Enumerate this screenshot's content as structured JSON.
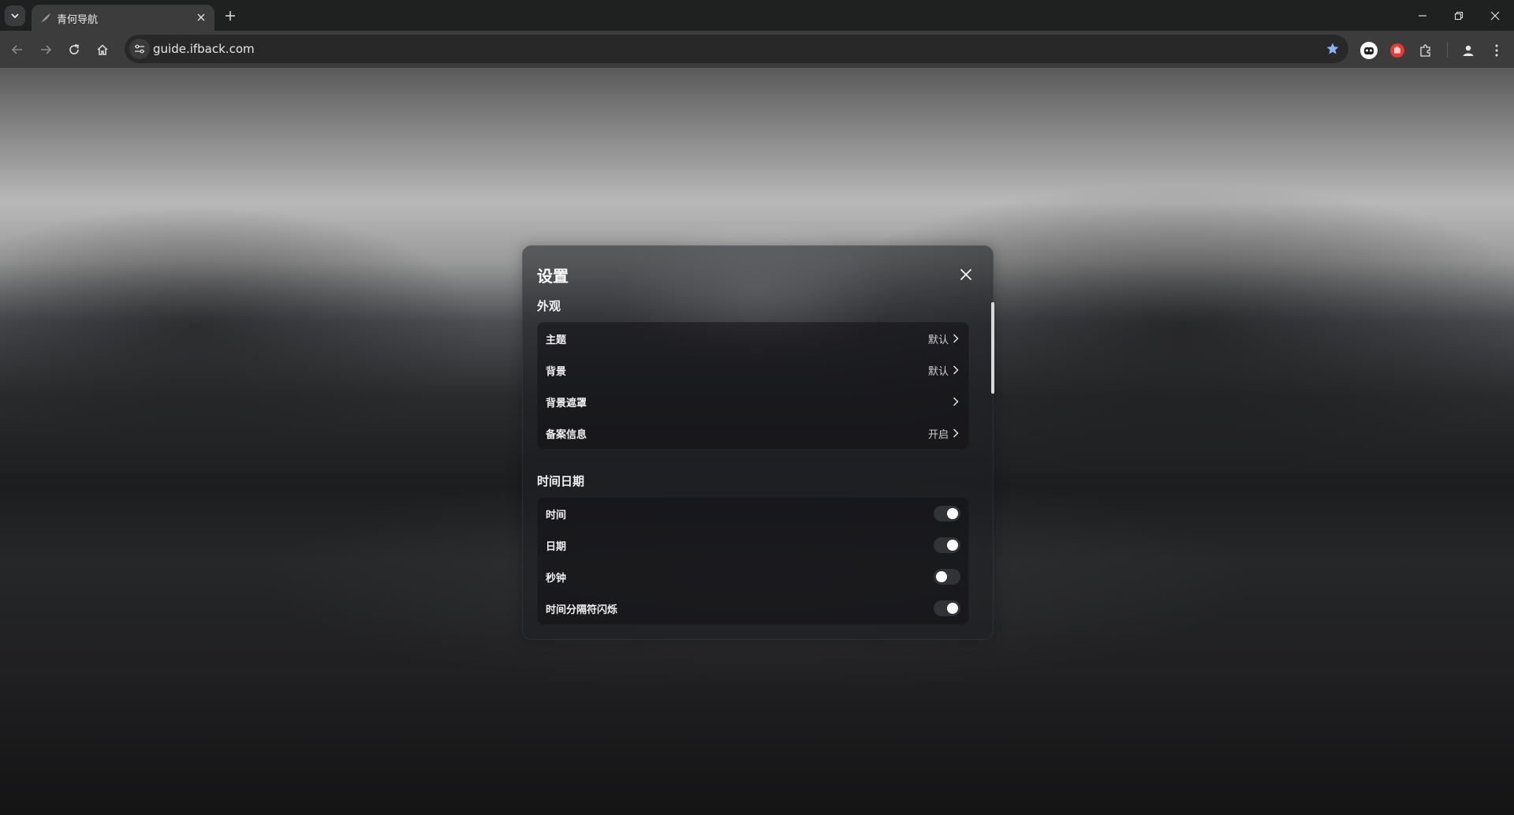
{
  "browser": {
    "tab": {
      "title": "青何导航"
    },
    "address": {
      "url": "guide.ifback.com"
    }
  },
  "settings": {
    "title": "设置",
    "appearance": {
      "title": "外观",
      "items": [
        {
          "label": "主题",
          "value": "默认"
        },
        {
          "label": "背景",
          "value": "默认"
        },
        {
          "label": "背景遮罩",
          "value": ""
        },
        {
          "label": "备案信息",
          "value": "开启"
        }
      ]
    },
    "datetime": {
      "title": "时间日期",
      "items": [
        {
          "label": "时间",
          "enabled": true
        },
        {
          "label": "日期",
          "enabled": true
        },
        {
          "label": "秒钟",
          "enabled": false
        },
        {
          "label": "时间分隔符闪烁",
          "enabled": true
        }
      ]
    }
  },
  "colors": {
    "accent_star": "#8ab4f8",
    "extension_red": "#e53935"
  }
}
